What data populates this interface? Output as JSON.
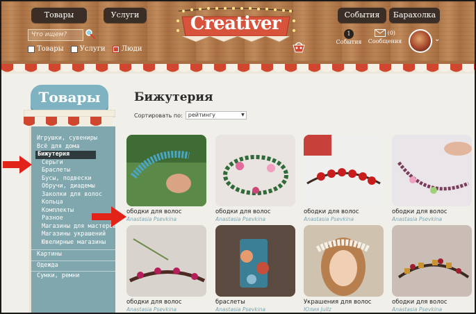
{
  "header": {
    "nav_left": [
      "Товары",
      "Услуги"
    ],
    "nav_right": [
      "События",
      "Барахолка"
    ],
    "search_placeholder": "Что ищем?",
    "filters": [
      {
        "label": "Товары",
        "checked": false
      },
      {
        "label": "Услуги",
        "checked": false
      },
      {
        "label": "Люди",
        "checked": true
      }
    ],
    "logo": "Creativer",
    "events_count": "1",
    "events_label": "События",
    "messages_count": "(0)",
    "messages_label": "Сообщения"
  },
  "sidebar": {
    "title": "Товары",
    "items": [
      {
        "label": "Игрушки, сувениры",
        "type": "top"
      },
      {
        "label": "Всё для дома",
        "type": "top"
      },
      {
        "label": "Бижутерия",
        "type": "active"
      },
      {
        "label": "Серьги",
        "type": "sub"
      },
      {
        "label": "Браслеты",
        "type": "sub"
      },
      {
        "label": "Бусы, подвески",
        "type": "sub"
      },
      {
        "label": "Обручи, диадемы",
        "type": "sub"
      },
      {
        "label": "Заколки для волос",
        "type": "sub"
      },
      {
        "label": "Кольца",
        "type": "sub"
      },
      {
        "label": "Комплекты",
        "type": "sub"
      },
      {
        "label": "Разное",
        "type": "sub"
      },
      {
        "label": "Магазины для мастеров",
        "type": "sub"
      },
      {
        "label": "Магазины украшений",
        "type": "sub"
      },
      {
        "label": "Ювелирные магазины",
        "type": "sub"
      },
      {
        "label": "Картины",
        "type": "gap"
      },
      {
        "label": "Одежда",
        "type": "gap"
      },
      {
        "label": "Сумки, ремни",
        "type": "gap"
      }
    ]
  },
  "main": {
    "title": "Бижутерия",
    "sort_label": "Сортировать по:",
    "sort_value": "рейтингу",
    "products": [
      {
        "title": "ободки для волос",
        "author": "Anastasia Psevkina"
      },
      {
        "title": "ободки для волос",
        "author": "Anastasia Psevkina"
      },
      {
        "title": "ободки для волос",
        "author": "Anastasia Psevkina"
      },
      {
        "title": "ободки для волос",
        "author": "Anastasia Psevkina"
      },
      {
        "title": "ободки для волос",
        "author": "Anastasia Psevkina"
      },
      {
        "title": "браслеты",
        "author": "Anastasia Psevkina"
      },
      {
        "title": "Украшения для волос",
        "author": "Юлия Jullz"
      },
      {
        "title": "ободки для волос",
        "author": "Anastasia Psevkina"
      }
    ]
  },
  "colors": {
    "wood": "#b0794c",
    "accent_red": "#d0462f",
    "sidebar_teal": "#7fa7ad",
    "author_blue": "#7da6b3"
  }
}
